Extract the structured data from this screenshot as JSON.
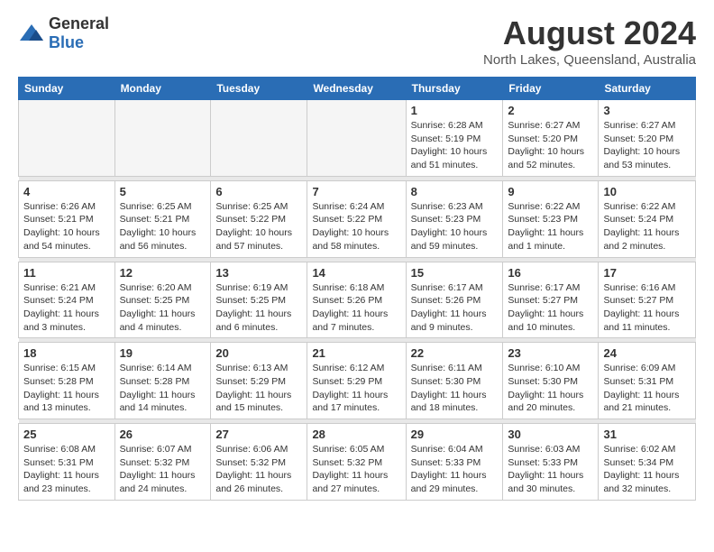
{
  "header": {
    "logo_general": "General",
    "logo_blue": "Blue",
    "month_year": "August 2024",
    "location": "North Lakes, Queensland, Australia"
  },
  "weekdays": [
    "Sunday",
    "Monday",
    "Tuesday",
    "Wednesday",
    "Thursday",
    "Friday",
    "Saturday"
  ],
  "weeks": [
    [
      {
        "num": "",
        "info": ""
      },
      {
        "num": "",
        "info": ""
      },
      {
        "num": "",
        "info": ""
      },
      {
        "num": "",
        "info": ""
      },
      {
        "num": "1",
        "info": "Sunrise: 6:28 AM\nSunset: 5:19 PM\nDaylight: 10 hours\nand 51 minutes."
      },
      {
        "num": "2",
        "info": "Sunrise: 6:27 AM\nSunset: 5:20 PM\nDaylight: 10 hours\nand 52 minutes."
      },
      {
        "num": "3",
        "info": "Sunrise: 6:27 AM\nSunset: 5:20 PM\nDaylight: 10 hours\nand 53 minutes."
      }
    ],
    [
      {
        "num": "4",
        "info": "Sunrise: 6:26 AM\nSunset: 5:21 PM\nDaylight: 10 hours\nand 54 minutes."
      },
      {
        "num": "5",
        "info": "Sunrise: 6:25 AM\nSunset: 5:21 PM\nDaylight: 10 hours\nand 56 minutes."
      },
      {
        "num": "6",
        "info": "Sunrise: 6:25 AM\nSunset: 5:22 PM\nDaylight: 10 hours\nand 57 minutes."
      },
      {
        "num": "7",
        "info": "Sunrise: 6:24 AM\nSunset: 5:22 PM\nDaylight: 10 hours\nand 58 minutes."
      },
      {
        "num": "8",
        "info": "Sunrise: 6:23 AM\nSunset: 5:23 PM\nDaylight: 10 hours\nand 59 minutes."
      },
      {
        "num": "9",
        "info": "Sunrise: 6:22 AM\nSunset: 5:23 PM\nDaylight: 11 hours\nand 1 minute."
      },
      {
        "num": "10",
        "info": "Sunrise: 6:22 AM\nSunset: 5:24 PM\nDaylight: 11 hours\nand 2 minutes."
      }
    ],
    [
      {
        "num": "11",
        "info": "Sunrise: 6:21 AM\nSunset: 5:24 PM\nDaylight: 11 hours\nand 3 minutes."
      },
      {
        "num": "12",
        "info": "Sunrise: 6:20 AM\nSunset: 5:25 PM\nDaylight: 11 hours\nand 4 minutes."
      },
      {
        "num": "13",
        "info": "Sunrise: 6:19 AM\nSunset: 5:25 PM\nDaylight: 11 hours\nand 6 minutes."
      },
      {
        "num": "14",
        "info": "Sunrise: 6:18 AM\nSunset: 5:26 PM\nDaylight: 11 hours\nand 7 minutes."
      },
      {
        "num": "15",
        "info": "Sunrise: 6:17 AM\nSunset: 5:26 PM\nDaylight: 11 hours\nand 9 minutes."
      },
      {
        "num": "16",
        "info": "Sunrise: 6:17 AM\nSunset: 5:27 PM\nDaylight: 11 hours\nand 10 minutes."
      },
      {
        "num": "17",
        "info": "Sunrise: 6:16 AM\nSunset: 5:27 PM\nDaylight: 11 hours\nand 11 minutes."
      }
    ],
    [
      {
        "num": "18",
        "info": "Sunrise: 6:15 AM\nSunset: 5:28 PM\nDaylight: 11 hours\nand 13 minutes."
      },
      {
        "num": "19",
        "info": "Sunrise: 6:14 AM\nSunset: 5:28 PM\nDaylight: 11 hours\nand 14 minutes."
      },
      {
        "num": "20",
        "info": "Sunrise: 6:13 AM\nSunset: 5:29 PM\nDaylight: 11 hours\nand 15 minutes."
      },
      {
        "num": "21",
        "info": "Sunrise: 6:12 AM\nSunset: 5:29 PM\nDaylight: 11 hours\nand 17 minutes."
      },
      {
        "num": "22",
        "info": "Sunrise: 6:11 AM\nSunset: 5:30 PM\nDaylight: 11 hours\nand 18 minutes."
      },
      {
        "num": "23",
        "info": "Sunrise: 6:10 AM\nSunset: 5:30 PM\nDaylight: 11 hours\nand 20 minutes."
      },
      {
        "num": "24",
        "info": "Sunrise: 6:09 AM\nSunset: 5:31 PM\nDaylight: 11 hours\nand 21 minutes."
      }
    ],
    [
      {
        "num": "25",
        "info": "Sunrise: 6:08 AM\nSunset: 5:31 PM\nDaylight: 11 hours\nand 23 minutes."
      },
      {
        "num": "26",
        "info": "Sunrise: 6:07 AM\nSunset: 5:32 PM\nDaylight: 11 hours\nand 24 minutes."
      },
      {
        "num": "27",
        "info": "Sunrise: 6:06 AM\nSunset: 5:32 PM\nDaylight: 11 hours\nand 26 minutes."
      },
      {
        "num": "28",
        "info": "Sunrise: 6:05 AM\nSunset: 5:32 PM\nDaylight: 11 hours\nand 27 minutes."
      },
      {
        "num": "29",
        "info": "Sunrise: 6:04 AM\nSunset: 5:33 PM\nDaylight: 11 hours\nand 29 minutes."
      },
      {
        "num": "30",
        "info": "Sunrise: 6:03 AM\nSunset: 5:33 PM\nDaylight: 11 hours\nand 30 minutes."
      },
      {
        "num": "31",
        "info": "Sunrise: 6:02 AM\nSunset: 5:34 PM\nDaylight: 11 hours\nand 32 minutes."
      }
    ]
  ]
}
